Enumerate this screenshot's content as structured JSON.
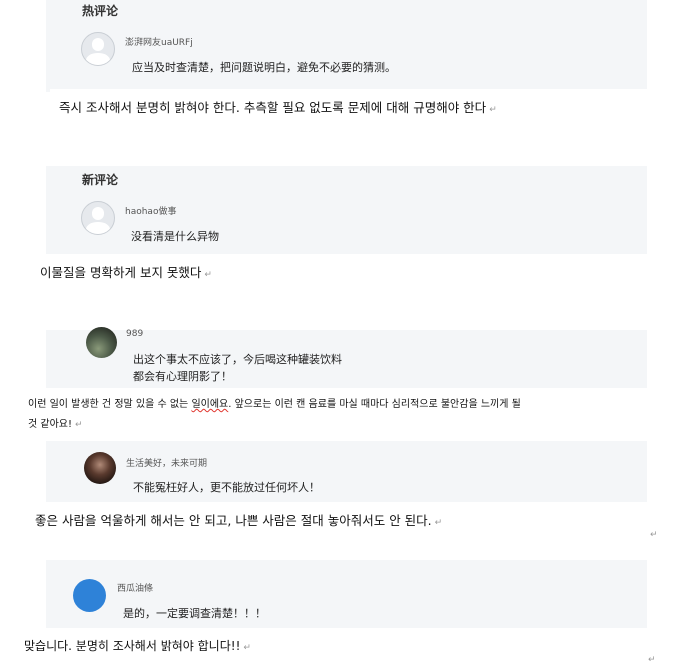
{
  "hot_section": {
    "title": "热评论",
    "comment": {
      "user": "澎湃网友uaURFj",
      "text": "应当及时查清楚，把问题说明白，避免不必要的猜测。"
    },
    "translation": "즉시 조사해서 분명히 밝혀야 한다. 추측할 필요 없도록 문제에 대해 규명해야 한다"
  },
  "new_section": {
    "title": "新评论",
    "comment": {
      "user": "haohao做事",
      "text": "没看清是什么异物"
    },
    "translation": "이물질을 명확하게 보지 못했다"
  },
  "comment_989": {
    "user": "989",
    "text_line1": "出这个事太不应该了，今后喝这种罐装饮料",
    "text_line2": "都会有心理阴影了！",
    "translation_part1": "이런 일이 발생한 건 정말 있을 수 없는 ",
    "translation_underlined": "일이에요",
    "translation_part2": ". 앞으로는 이런 캔 음료를 마실 때마다 심리적으로 불안감을 느끼게 될",
    "translation_line2": "것 같아요!"
  },
  "comment_life": {
    "user": "生活美好，未来可期",
    "text": "不能冤枉好人，更不能放过任何坏人！",
    "translation": "좋은 사람을 억울하게 해서는 안 되고, 나쁜 사람은 절대 놓아줘서도 안 된다."
  },
  "comment_watermelon": {
    "user": "西瓜油條",
    "text": "是的，一定要调查清楚！！！",
    "translation": "맞습니다. 분명히 조사해서 밝혀야 합니다!!"
  },
  "paragraph_mark": "↵",
  "colors": {
    "panel_bg": "#f4f6f8",
    "avatar_blue": "#2e82d8"
  }
}
